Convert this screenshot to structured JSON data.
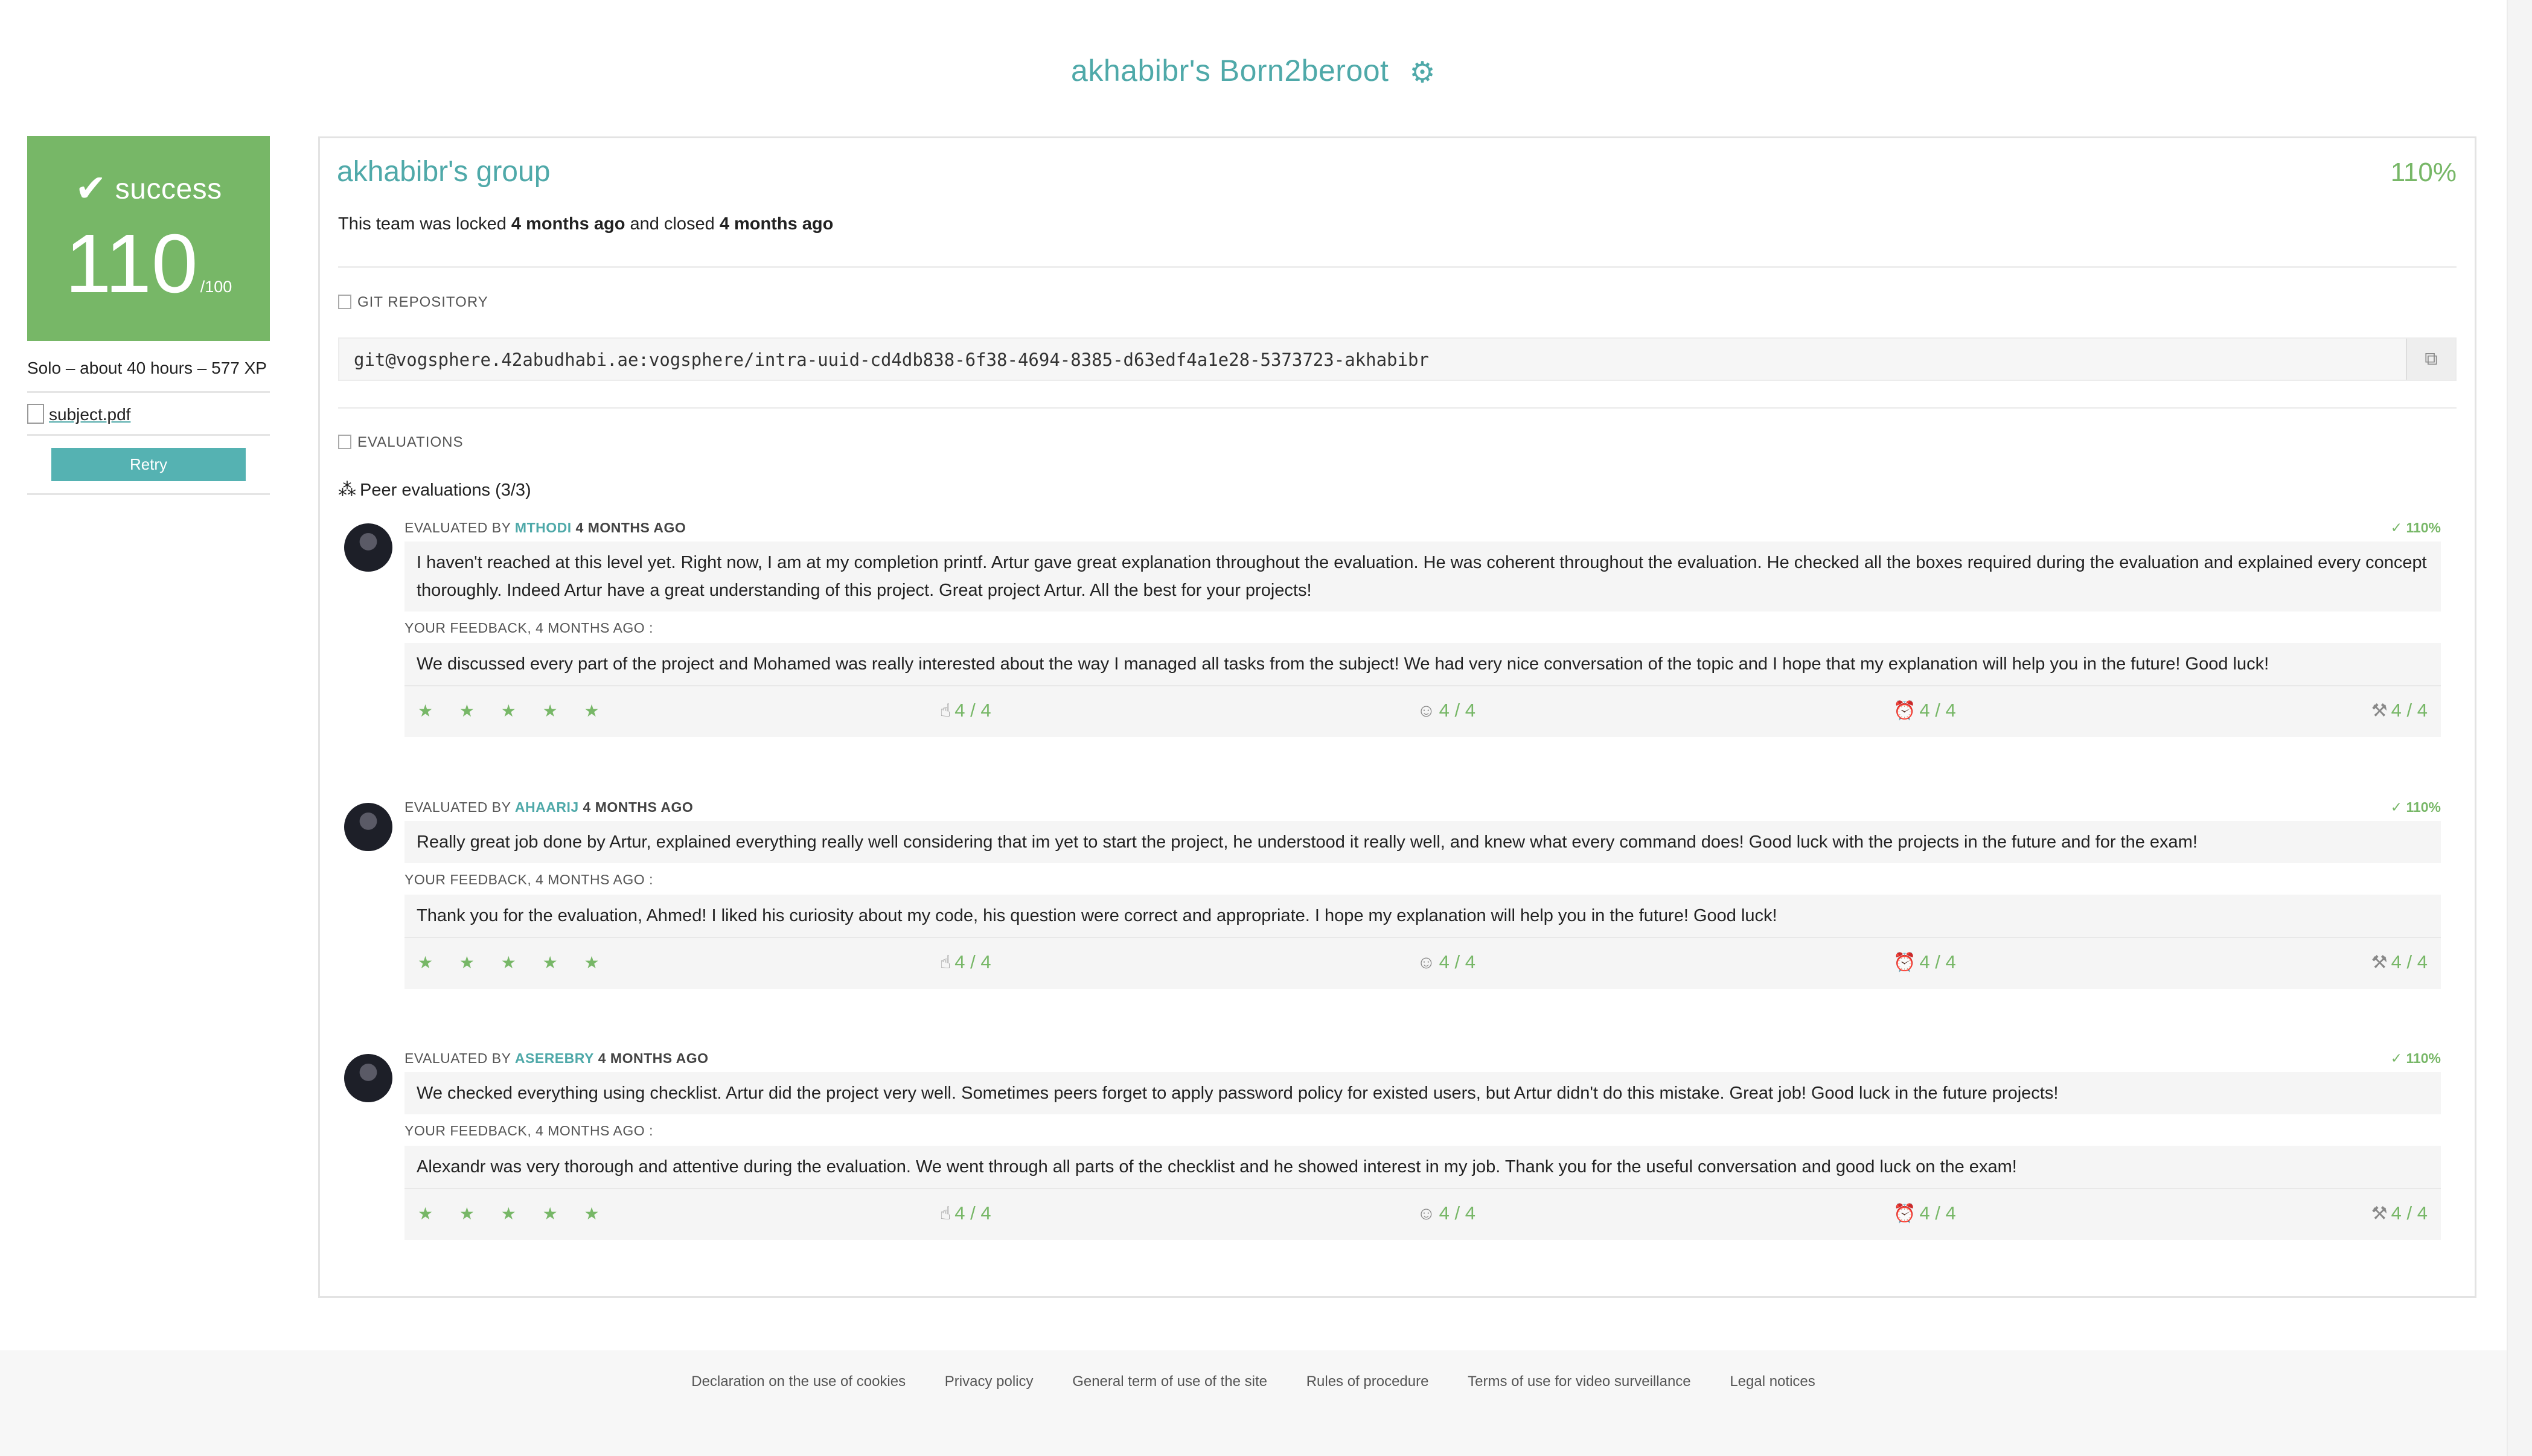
{
  "page": {
    "title": "akhabibr's Born2beroot",
    "settings_icon": "gear-icon"
  },
  "sidebar": {
    "status": "success",
    "score": "110",
    "score_max": "/100",
    "info": "Solo – about 40 hours – 577 XP",
    "file": "subject.pdf",
    "retry": "Retry"
  },
  "team": {
    "name": "akhabibr's group",
    "final_mark": "110%",
    "locked_prefix": "This team was locked",
    "locked_when": "4 months ago",
    "closed_prefix": "and closed",
    "closed_when": "4 months ago"
  },
  "repo": {
    "label": "GIT REPOSITORY",
    "url": "git@vogsphere.42abudhabi.ae:vogsphere/intra-uuid-cd4db838-6f38-4694-8385-d63edf4a1e28-5373723-akhabibr",
    "copy_icon": "clipboard-icon"
  },
  "evaluations": {
    "label": "EVALUATIONS",
    "peer_heading": "Peer evaluations (3/3)",
    "items": [
      {
        "evaluated_by": "EVALUATED BY",
        "login": "MTHODI",
        "ago": "4 MONTHS AGO",
        "mark": "110%",
        "comment": "I haven't reached at this level yet. Right now, I am at my completion printf. Artur gave great explanation throughout the evaluation. He was coherent throughout the evaluation. He checked all the boxes required during the evaluation and explained every concept thoroughly. Indeed Artur have a great understanding of this project. Great project Artur. All the best for your projects!",
        "feedback_label": "YOUR FEEDBACK, 4 MONTHS AGO :",
        "feedback": "We discussed every part of the project and Mohamed was really interested about the way I managed all tasks from the subject! We had very nice conversation of the topic and I hope that my explanation will help you in the future! Good luck!",
        "stars": "★ ★ ★ ★ ★",
        "ratings": [
          "4 / 4",
          "4 / 4",
          "4 / 4",
          "4 / 4"
        ]
      },
      {
        "evaluated_by": "EVALUATED BY",
        "login": "AHAARIJ",
        "ago": "4 MONTHS AGO",
        "mark": "110%",
        "comment": "Really great job done by Artur, explained everything really well considering that im yet to start the project, he understood it really well, and knew what every command does! Good luck with the projects in the future and for the exam!",
        "feedback_label": "YOUR FEEDBACK, 4 MONTHS AGO :",
        "feedback": "Thank you for the evaluation, Ahmed! I liked his curiosity about my code, his question were correct and appropriate. I hope my explanation will help you in the future! Good luck!",
        "stars": "★ ★ ★ ★ ★",
        "ratings": [
          "4 / 4",
          "4 / 4",
          "4 / 4",
          "4 / 4"
        ]
      },
      {
        "evaluated_by": "EVALUATED BY",
        "login": "ASEREBRY",
        "ago": "4 MONTHS AGO",
        "mark": "110%",
        "comment": "We checked everything using checklist. Artur did the project very well. Sometimes peers forget to apply password policy for existed users, but Artur didn't do this mistake. Great job! Good luck in the future projects!",
        "feedback_label": "YOUR FEEDBACK, 4 MONTHS AGO :",
        "feedback": "Alexandr was very thorough and attentive during the evaluation. We went through all parts of the checklist and he showed interest in my job. Thank you for the useful conversation and good luck on the exam!",
        "stars": "★ ★ ★ ★ ★",
        "ratings": [
          "4 / 4",
          "4 / 4",
          "4 / 4",
          "4 / 4"
        ]
      }
    ]
  },
  "footer": {
    "links": [
      "Declaration on the use of cookies",
      "Privacy policy",
      "General term of use of the site",
      "Rules of procedure",
      "Terms of use for video surveillance",
      "Legal notices"
    ]
  },
  "colors": {
    "accent": "#4fa9a9",
    "success": "#77b767"
  }
}
